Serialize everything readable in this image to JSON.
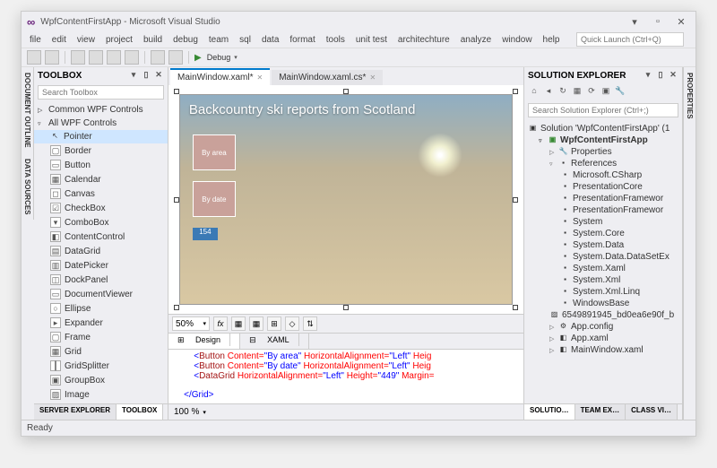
{
  "title": "WpfContentFirstApp - Microsoft Visual Studio",
  "menu": [
    "file",
    "edit",
    "view",
    "project",
    "build",
    "debug",
    "team",
    "sql",
    "data",
    "format",
    "tools",
    "unit test",
    "architechture",
    "analyze",
    "window",
    "help"
  ],
  "quickLaunch": {
    "placeholder": "Quick Launch (Ctrl+Q)"
  },
  "toolbar": {
    "debug": "Debug"
  },
  "leftTabs": [
    "DOCUMENT OUTLINE",
    "DATA SOURCES"
  ],
  "rightTab": "PROPERTIES",
  "toolbox": {
    "title": "TOOLBOX",
    "searchPH": "Search Toolbox",
    "groups": {
      "collapsed": "Common WPF Controls",
      "open": "All WPF Controls"
    },
    "items": [
      "Pointer",
      "Border",
      "Button",
      "Calendar",
      "Canvas",
      "CheckBox",
      "ComboBox",
      "ContentControl",
      "DataGrid",
      "DatePicker",
      "DockPanel",
      "DocumentViewer",
      "Ellipse",
      "Expander",
      "Frame",
      "Grid",
      "GridSplitter",
      "GroupBox",
      "Image"
    ],
    "bottomTabs": [
      "SERVER EXPLORER",
      "TOOLBOX"
    ]
  },
  "docs": {
    "tab1": "MainWindow.xaml*",
    "tab2": "MainWindow.xaml.cs*"
  },
  "design": {
    "heading": "Backcountry ski reports from Scotland",
    "btn1": "By area",
    "btn2": "By date",
    "grid": "154"
  },
  "split": {
    "zoom": "50%",
    "designTab": "Design",
    "xamlTab": "XAML"
  },
  "xaml": {
    "l1a": "<Button",
    "l1b": " Content=",
    "l1c": "\"By area\"",
    "l1d": " HorizontalAlignment=",
    "l1e": "\"Left\"",
    "l1f": " Heig",
    "l2a": "<Button",
    "l2b": " Content=",
    "l2c": "\"By date\"",
    "l2d": " HorizontalAlignment=",
    "l2e": "\"Left\"",
    "l2f": " Heig",
    "l3a": "<DataGrid",
    "l3b": " HorizontalAlignment=",
    "l3c": "\"Left\"",
    "l3d": " Height=",
    "l3e": "\"449\"",
    "l3f": " Margin=",
    "l4": "</Grid>"
  },
  "centerFoot": {
    "pct": "100 %"
  },
  "solution": {
    "title": "SOLUTION EXPLORER",
    "searchPH": "Search Solution Explorer (Ctrl+;)",
    "root": "Solution 'WpfContentFirstApp' (1",
    "proj": "WpfContentFirstApp",
    "props": "Properties",
    "refs": "References",
    "refItems": [
      "Microsoft.CSharp",
      "PresentationCore",
      "PresentationFramewor",
      "PresentationFramewor",
      "System",
      "System.Core",
      "System.Data",
      "System.Data.DataSetEx",
      "System.Xaml",
      "System.Xml",
      "System.Xml.Linq",
      "WindowsBase"
    ],
    "extra": [
      "6549891945_bd0ea6e90f_b",
      "App.config",
      "App.xaml",
      "MainWindow.xaml"
    ],
    "bottomTabs": [
      "SOLUTIO…",
      "TEAM EX…",
      "CLASS VI…"
    ]
  },
  "status": "Ready"
}
